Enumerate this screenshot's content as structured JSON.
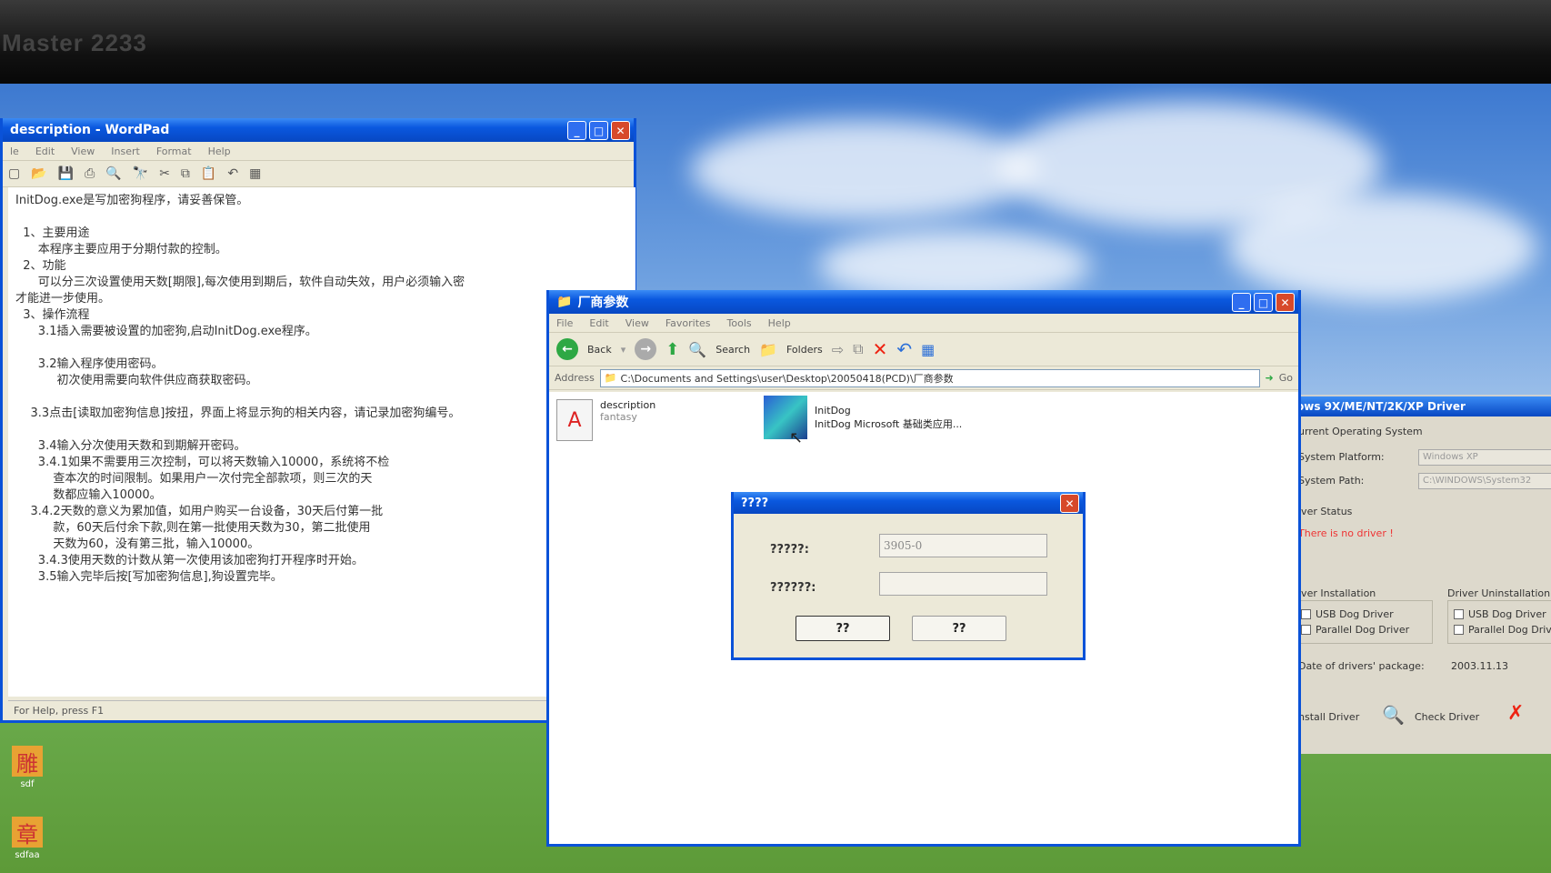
{
  "monitor": {
    "brand": "Master 2233"
  },
  "wordpad": {
    "title": "description - WordPad",
    "menu": [
      "le",
      "Edit",
      "View",
      "Insert",
      "Format",
      "Help"
    ],
    "lines": [
      "InitDog.exe是写加密狗程序，请妥善保管。",
      "",
      "  1、主要用途",
      "      本程序主要应用于分期付款的控制。",
      "  2、功能",
      "      可以分三次设置使用天数[期限],每次使用到期后，软件自动失效，用户必须输入密",
      "才能进一步使用。",
      "  3、操作流程",
      "      3.1插入需要被设置的加密狗,启动InitDog.exe程序。",
      "",
      "      3.2输入程序使用密码。",
      "           初次使用需要向软件供应商获取密码。",
      "",
      "    3.3点击[读取加密狗信息]按扭，界面上将显示狗的相关内容，请记录加密狗编号。",
      "",
      "      3.4输入分次使用天数和到期解开密码。",
      "      3.4.1如果不需要用三次控制，可以将天数输入10000，系统将不检",
      "          查本次的时间限制。如果用户一次付完全部款项，则三次的天",
      "          数都应输入10000。",
      "    3.4.2天数的意义为累加值，如用户购买一台设备，30天后付第一批",
      "          款，60天后付余下款,则在第一批使用天数为30，第二批使用",
      "          天数为60，没有第三批，输入10000。",
      "      3.4.3使用天数的计数从第一次使用该加密狗打开程序时开始。",
      "      3.5输入完毕后按[写加密狗信息],狗设置完毕。"
    ],
    "status": "For Help, press F1"
  },
  "explorer": {
    "title": "厂商参数",
    "menu": [
      "File",
      "Edit",
      "View",
      "Favorites",
      "Tools",
      "Help"
    ],
    "toolbar": {
      "back": "Back",
      "search": "Search",
      "folders": "Folders"
    },
    "address_label": "Address",
    "address": "C:\\Documents and Settings\\user\\Desktop\\20050418(PCD)\\厂商参数",
    "go": "Go",
    "files": [
      {
        "name": "description",
        "sub": "fantasy"
      },
      {
        "name": "InitDog",
        "sub": "InitDog Microsoft 基础类应用..."
      }
    ]
  },
  "dialog": {
    "title": "????",
    "field1_label": "?????:",
    "field1_value": "3905-0",
    "field2_label": "??????:",
    "field2_value": "",
    "ok": "??",
    "cancel": "??"
  },
  "driver_panel": {
    "title": "ows 9X/ME/NT/2K/XP Driver",
    "current_os": "urrent Operating System",
    "platform_label": "System Platform:",
    "platform_value": "Windows XP",
    "path_label": "System Path:",
    "path_value": "C:\\WINDOWS\\System32",
    "status_label": "iver Status",
    "status_value": "There is no driver !",
    "install_label": "iver Installation",
    "uninstall_label": "Driver Uninstallation",
    "usb": "USB Dog Driver",
    "parallel": "Parallel Dog Driver",
    "date_label": "Date of drivers' package:",
    "date_value": "2003.11.13",
    "install_btn": "nstall Driver",
    "check_btn": "Check Driver"
  },
  "desktop_icons": [
    {
      "label": "sdf",
      "glyph": "雕"
    },
    {
      "label": "sdfaa",
      "glyph": "章"
    }
  ]
}
